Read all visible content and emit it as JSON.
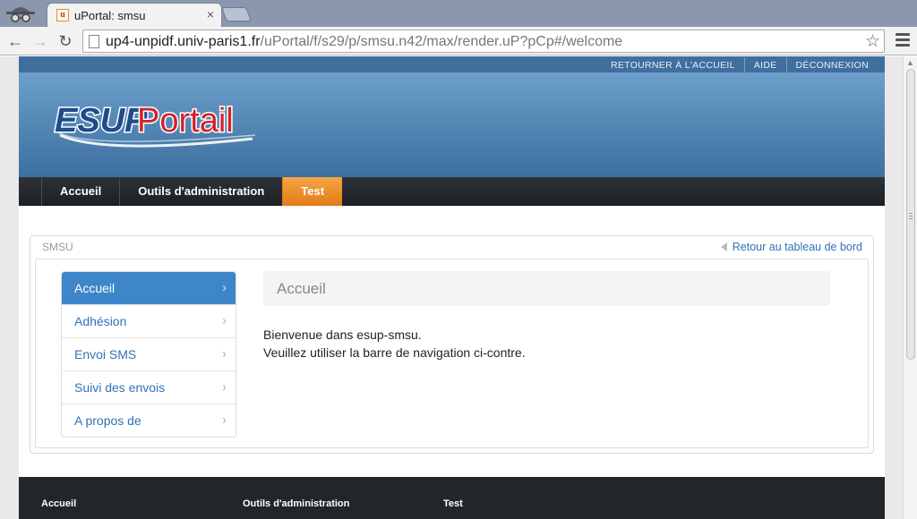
{
  "browser": {
    "tab_title": "uPortal: smsu",
    "tab_close": "×",
    "url_host": "up4-unpidf.univ-paris1.fr",
    "url_path": "/uPortal/f/s29/p/smsu.n42/max/render.uP?pCp#/welcome"
  },
  "header": {
    "links": [
      "RETOURNER À L'ACCUEIL",
      "AIDE",
      "DÉCONNEXION"
    ],
    "logo_text_esup": "ESUP",
    "logo_text_portail": "Portail"
  },
  "main_nav": {
    "items": [
      "Accueil",
      "Outils d'administration",
      "Test"
    ],
    "active": "Test"
  },
  "portlet": {
    "title": "SMSU",
    "back_link": "Retour au tableau de bord",
    "side_nav": [
      "Accueil",
      "Adhésion",
      "Envoi SMS",
      "Suivi des envois",
      "A propos de"
    ],
    "side_nav_active": "Accueil",
    "heading": "Accueil",
    "text_line_1": "Bienvenue dans esup-smsu.",
    "text_line_2": "Veuillez utiliser la barre de navigation ci-contre."
  },
  "footer": {
    "items": [
      "Accueil",
      "Outils d'administration",
      "Test"
    ]
  },
  "colors": {
    "topbar": "#3f6f9f",
    "nav_active": "#f08c25",
    "link": "#2f73b6",
    "sidenav_active": "#3d87c9",
    "footer": "#22262b"
  }
}
